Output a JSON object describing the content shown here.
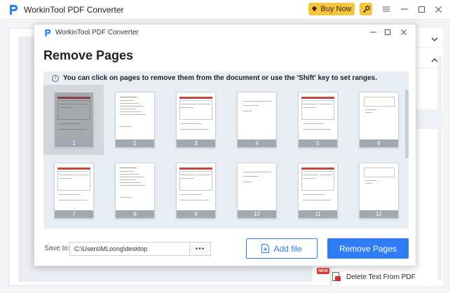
{
  "app": {
    "title": "WorkinTool PDF Converter",
    "buy_now_label": "Buy Now",
    "accent": "#2e7cf6",
    "buy_color": "#f5c542"
  },
  "dialog": {
    "title": "WorkinTool PDF Converter",
    "heading": "Remove Pages",
    "info": "You can click on pages to remove them from the document or use the 'Shift' key to set ranges.",
    "pages": [
      {
        "number": "1",
        "selected": true
      },
      {
        "number": "2",
        "selected": false
      },
      {
        "number": "3",
        "selected": false
      },
      {
        "number": "4",
        "selected": false
      },
      {
        "number": "5",
        "selected": false
      },
      {
        "number": "6",
        "selected": false
      },
      {
        "number": "7",
        "selected": false
      },
      {
        "number": "8",
        "selected": false
      },
      {
        "number": "9",
        "selected": false
      },
      {
        "number": "10",
        "selected": false
      },
      {
        "number": "11",
        "selected": false
      },
      {
        "number": "12",
        "selected": false
      }
    ],
    "save_to_label": "Save to:",
    "save_path": "C:\\Users\\MLoong\\desktop",
    "browse_label": "•••",
    "add_file_label": "Add file",
    "remove_pages_label": "Remove Pages"
  },
  "background": {
    "new_badge": "NEW",
    "delete_text_label": "Delete Text From PDF"
  }
}
